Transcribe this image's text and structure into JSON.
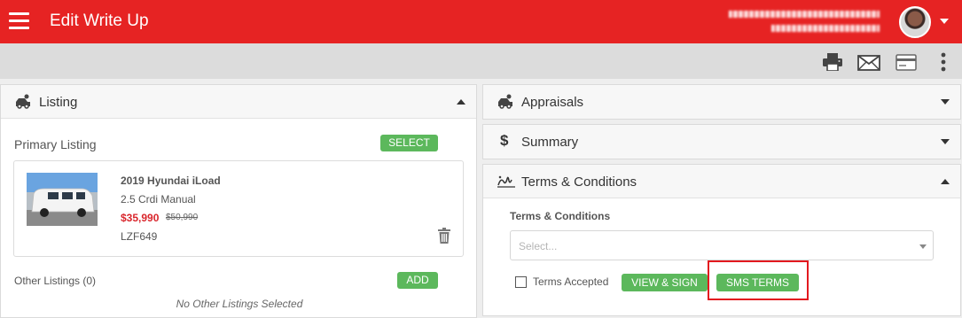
{
  "header": {
    "title": "Edit Write Up",
    "menu_icon": "hamburger-menu-icon",
    "avatar_icon": "user-avatar",
    "colors": {
      "brand": "#e62323"
    }
  },
  "toolbar": {
    "icons": [
      "print-icon",
      "email-icon",
      "payment-card-icon",
      "more-vertical-icon"
    ]
  },
  "listing": {
    "title": "Listing",
    "icon": "car-icon",
    "primary_label": "Primary Listing",
    "select_label": "SELECT",
    "vehicle": {
      "title": "2019 Hyundai iLoad",
      "trim": "2.5 Crdi Manual",
      "price": "$35,990",
      "old_price": "$50,990",
      "stock": "LZF649"
    },
    "other_label": "Other Listings (0)",
    "add_label": "ADD",
    "empty_text": "No Other Listings Selected"
  },
  "appraisals": {
    "title": "Appraisals",
    "icon": "car-icon"
  },
  "summary": {
    "title": "Summary",
    "icon": "dollar-icon"
  },
  "terms": {
    "title": "Terms & Conditions",
    "icon": "signature-icon",
    "field_label": "Terms & Conditions",
    "placeholder": "Select...",
    "accepted_label": "Terms Accepted",
    "accepted": false,
    "view_sign_label": "VIEW & SIGN",
    "sms_label": "SMS TERMS"
  }
}
